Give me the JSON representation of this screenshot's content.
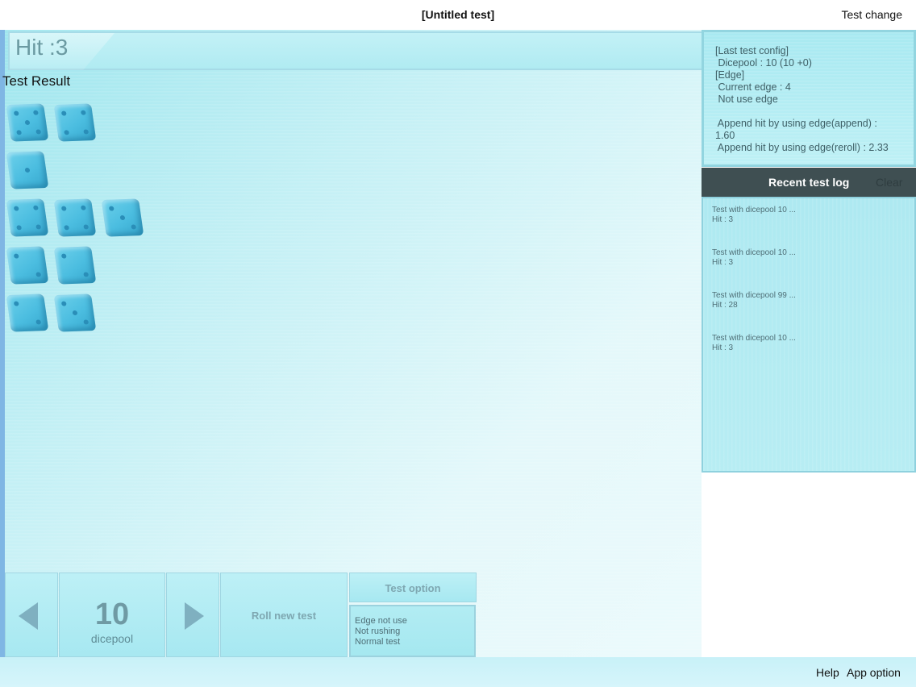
{
  "topbar": {
    "title": "[Untitled test]",
    "right_button": "Test change"
  },
  "result": {
    "hit_label": "Hit :3",
    "section_title": "Test Result",
    "dice_rows": [
      [
        5,
        4
      ],
      [
        1
      ],
      [
        4,
        4,
        3
      ],
      [
        2,
        2
      ],
      [
        2,
        3
      ]
    ]
  },
  "controls": {
    "dice_count": "10",
    "dice_count_label": "dicepool",
    "roll_label": "Roll new test",
    "option_title": "Test option",
    "option_lines": [
      "Edge not use",
      "Not rushing",
      "Normal test"
    ]
  },
  "config": {
    "lines": [
      "[Last test config]",
      " Dicepool : 10 (10 +0)",
      "[Edge]",
      " Current edge : 4",
      " Not use edge",
      "",
      " Append hit by using edge(append) :",
      "1.60",
      " Append hit by using edge(reroll) : 2.33"
    ]
  },
  "log": {
    "title": "Recent test log",
    "clear": "Clear",
    "items": [
      {
        "line1": "Test with dicepool 10 ...",
        "line2": "Hit : 3"
      },
      {
        "line1": "Test with dicepool 10 ...",
        "line2": "Hit : 3"
      },
      {
        "line1": "Test with dicepool 99 ...",
        "line2": "Hit : 28"
      },
      {
        "line1": "Test with dicepool 10 ...",
        "line2": "Hit : 3"
      }
    ]
  },
  "bottombar": {
    "help": "Help",
    "app_option": "App option"
  },
  "icons": {
    "dice": "die-icon",
    "prev": "left-arrow-icon",
    "next": "right-arrow-icon"
  }
}
